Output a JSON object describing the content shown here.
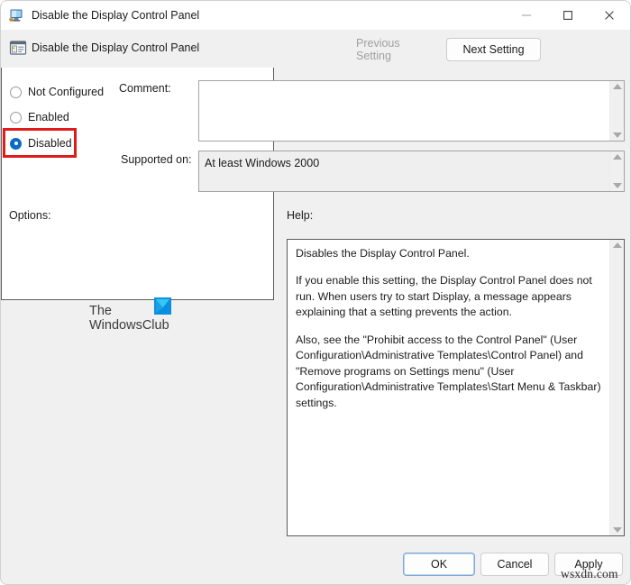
{
  "window": {
    "title": "Disable the Display Control Panel",
    "icon": "display-monitor-icon",
    "controls": {
      "minimize": "minimize-icon",
      "maximize": "maximize-icon",
      "close": "close-icon"
    }
  },
  "header": {
    "setting_icon": "policy-setting-icon",
    "setting_title": "Disable the Display Control Panel",
    "previous_setting_label": "Previous Setting",
    "next_setting_label": "Next Setting",
    "previous_setting_enabled": false,
    "next_setting_enabled": true
  },
  "state": {
    "options": [
      {
        "label": "Not Configured",
        "selected": false
      },
      {
        "label": "Enabled",
        "selected": false
      },
      {
        "label": "Disabled",
        "selected": true
      }
    ],
    "selected_value": "Disabled",
    "highlight_color": "#e01b1b"
  },
  "fields": {
    "comment_label": "Comment:",
    "comment_value": "",
    "supported_label": "Supported on:",
    "supported_value": "At least Windows 2000"
  },
  "panels": {
    "options_label": "Options:",
    "help_label": "Help:",
    "options_content": "",
    "help_paragraphs": [
      "Disables the Display Control Panel.",
      "If you enable this setting, the Display Control Panel does not run. When users try to start Display, a message appears explaining that a setting prevents the action.",
      "Also, see the \"Prohibit access to the Control Panel\" (User Configuration\\Administrative Templates\\Control Panel) and \"Remove programs on Settings menu\" (User Configuration\\Administrative Templates\\Start Menu & Taskbar) settings."
    ]
  },
  "watermark": {
    "line1": "The",
    "line2": "WindowsClub",
    "logo": "windowsclub-logo-icon",
    "logo_color": "#0aa2e8",
    "site": "wsxdn.com"
  },
  "footer": {
    "ok_label": "OK",
    "cancel_label": "Cancel",
    "apply_label": "Apply"
  }
}
